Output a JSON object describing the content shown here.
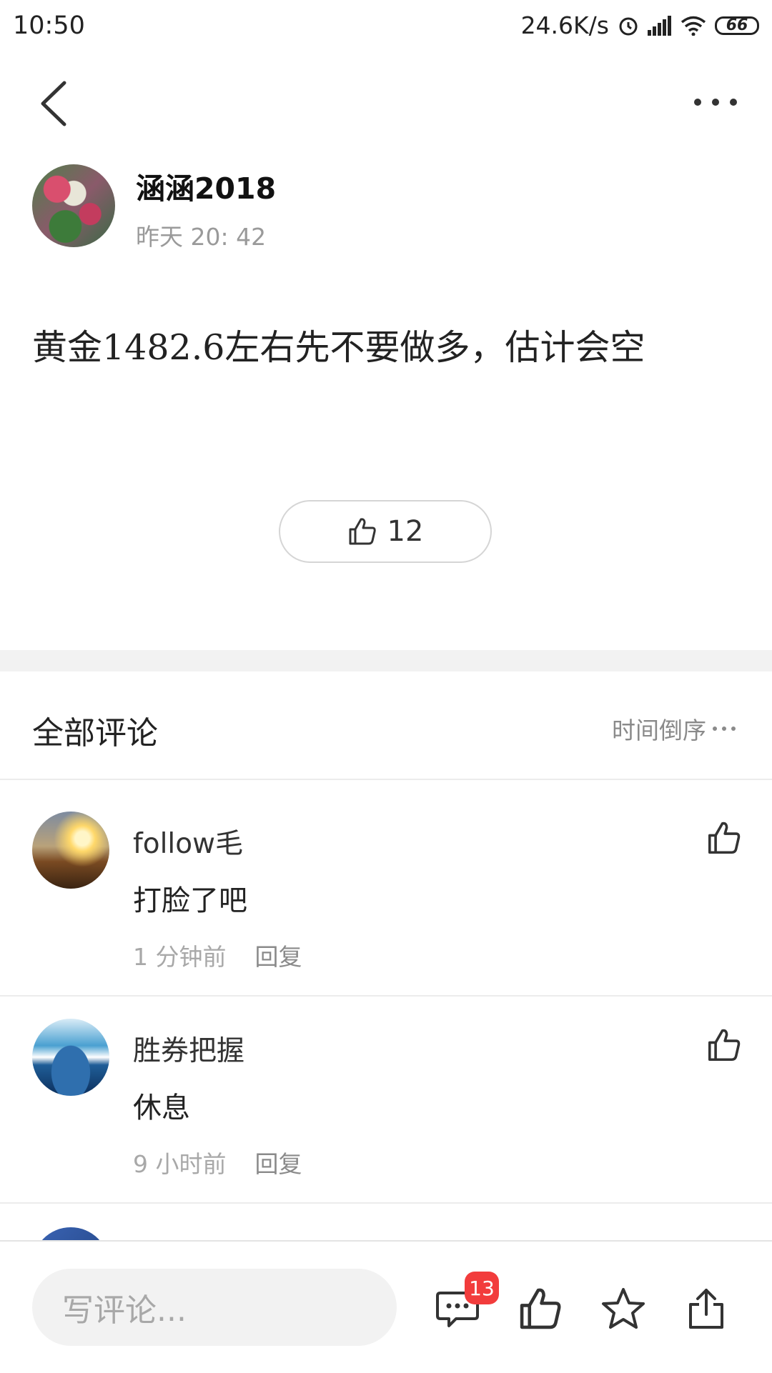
{
  "status_bar": {
    "time": "10:50",
    "speed": "24.6K/s",
    "battery": "66"
  },
  "author": {
    "name": "涵涵2018",
    "time": "昨天 20: 42"
  },
  "post": {
    "text": "黄金1482.6左右先不要做多，估计会空",
    "like_count": "12"
  },
  "comments_section": {
    "title": "全部评论",
    "sort_label": "时间倒序"
  },
  "comments": [
    {
      "name": "follow毛",
      "text": "打脸了吧",
      "time": "1 分钟前",
      "reply": "回复"
    },
    {
      "name": "胜券把握",
      "text": "休息",
      "time": "9 小时前",
      "reply": "回复"
    }
  ],
  "bottom_bar": {
    "placeholder": "写评论...",
    "comment_badge": "13"
  },
  "colors": {
    "badge": "#f23c3c",
    "muted_text": "#a8a8a8"
  }
}
